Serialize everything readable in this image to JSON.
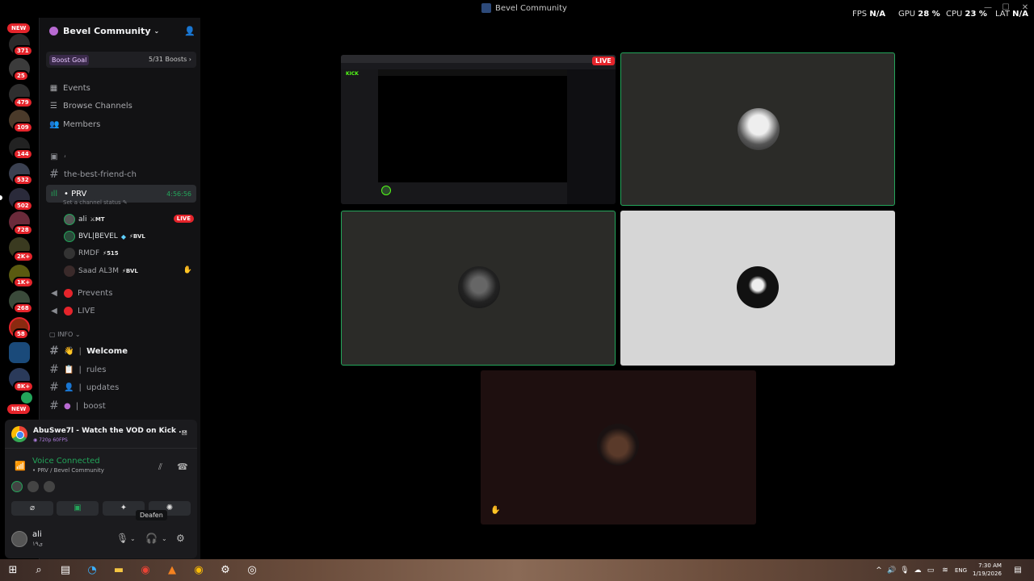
{
  "window": {
    "title": "Bevel Community"
  },
  "overlay": {
    "fps_label": "FPS",
    "fps_value": "N/A",
    "gpu_label": "GPU",
    "gpu_value": "28 %",
    "cpu_label": "CPU",
    "cpu_value": "23 %",
    "lat_label": "LAT",
    "lat_value": "N/A"
  },
  "rail": {
    "new_top": "NEW",
    "new_bottom": "NEW",
    "badges": [
      "371",
      "25",
      "479",
      "109",
      "144",
      "532",
      "502",
      "728",
      "2K+",
      "1K+",
      "268",
      "58",
      "8K+"
    ]
  },
  "server": {
    "name": "Bevel Community",
    "boost_label": "Boost Goal",
    "boost_count": "5/31 Boosts"
  },
  "nav": [
    {
      "label": "Events",
      "icon": "calendar-icon"
    },
    {
      "label": "Browse Channels",
      "icon": "browse-icon"
    },
    {
      "label": "Members",
      "icon": "members-icon"
    }
  ],
  "channels": {
    "hidden1": "ۥ",
    "best_friend": "the-best-friend-ch",
    "prv": "• PRV",
    "prv_time": "4:56:56",
    "prv_status": "Set a channel status",
    "voice_users": [
      {
        "name": "ali",
        "tag": "MT",
        "live": "LIVE"
      },
      {
        "name": "BVL|BEVEL",
        "tag": "BVL"
      },
      {
        "name": "RMDF",
        "tag": "515"
      },
      {
        "name": "Saad AL3M",
        "tag": "BVL"
      }
    ],
    "prevents": "Prevents",
    "live": "LIVE",
    "info_category": "INFO",
    "welcome": "Welcome",
    "rules": "rules",
    "updates": "updates",
    "boost": "boost"
  },
  "activity": {
    "title": "AbuSwe7l - Watch the VOD on Kick ...",
    "subtitle": "720p 60FPS"
  },
  "voice": {
    "status": "Voice Connected",
    "location": "• PRV / Bevel Community"
  },
  "tooltip": {
    "deafen": "Deafen"
  },
  "user": {
    "name": "ali",
    "tag": "۱۹ی"
  },
  "stream": {
    "live": "LIVE"
  },
  "system": {
    "lang": "ENG",
    "time": "7:30 AM",
    "date": "1/19/2026"
  },
  "colors": {
    "accent_green": "#23a55a",
    "live_red": "#e5242b",
    "boost_purple": "#b86ad2"
  }
}
